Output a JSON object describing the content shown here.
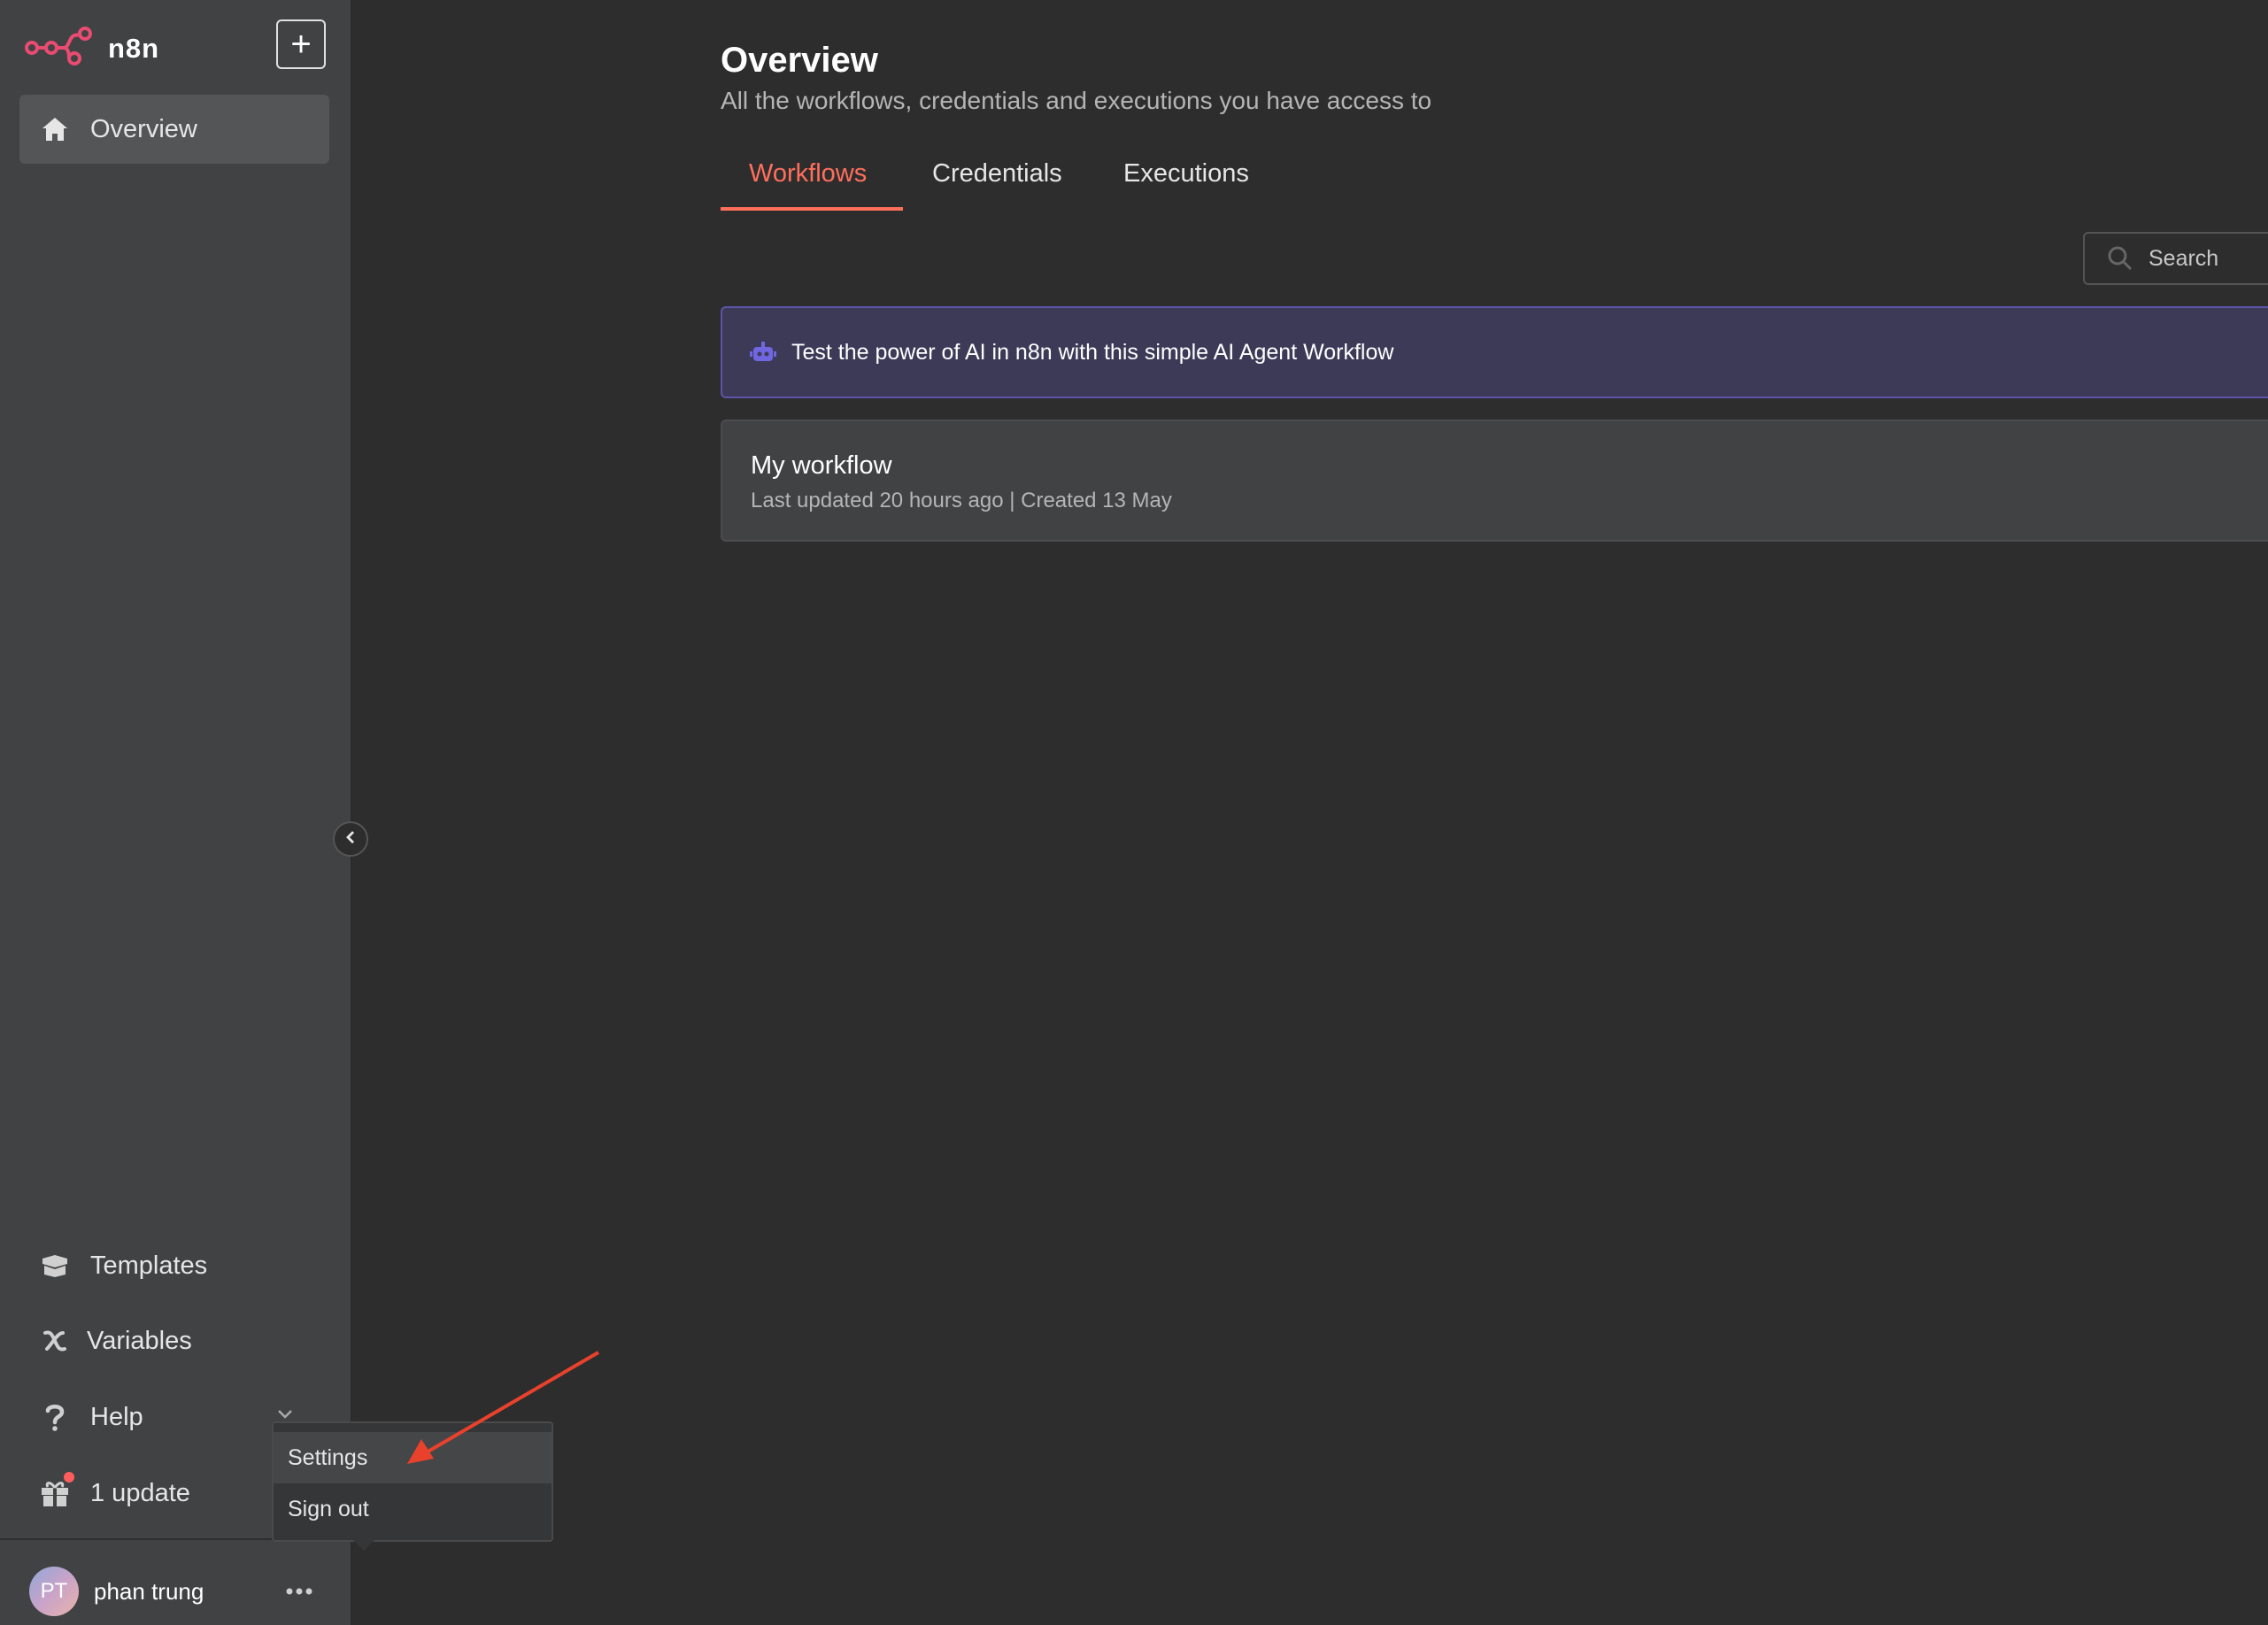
{
  "brand": {
    "name": "n8n",
    "logo_icon": "n8n-logo-icon",
    "accent": "#ea4b71"
  },
  "sidebar": {
    "add_button_icon": "plus-icon",
    "overview": {
      "label": "Overview",
      "icon": "home-icon"
    },
    "bottom_items": [
      {
        "label": "Templates",
        "icon": "templates-box-icon"
      },
      {
        "label": "Variables",
        "icon": "variable-x-icon"
      },
      {
        "label": "Help",
        "icon": "question-mark-icon"
      },
      {
        "label": "1 update",
        "icon": "gift-icon"
      }
    ],
    "collapse_icon": "chevron-left-icon"
  },
  "user": {
    "initials": "PT",
    "name": "phan trung",
    "more_icon": "ellipsis-icon"
  },
  "user_menu": {
    "items": [
      "Settings",
      "Sign out"
    ],
    "highlighted": "Settings"
  },
  "main": {
    "title": "Overview",
    "subtitle": "All the workflows, credentials and executions you have access to",
    "tabs": [
      {
        "label": "Workflows",
        "active": true
      },
      {
        "label": "Credentials",
        "active": false
      },
      {
        "label": "Executions",
        "active": false
      }
    ],
    "search": {
      "placeholder": "Search",
      "value": ""
    },
    "ai_banner": {
      "text": "Test the power of AI in n8n with this simple AI Agent Workflow",
      "icon": "robot-icon"
    },
    "workflows": [
      {
        "name": "My workflow",
        "meta": "Last updated 20 hours ago | Created 13 May"
      }
    ]
  },
  "colors": {
    "active_tab": "#ff6f5c",
    "banner_bg": "#3d3a58",
    "banner_border": "#5b54a8",
    "annotation_arrow": "#e8412c"
  }
}
